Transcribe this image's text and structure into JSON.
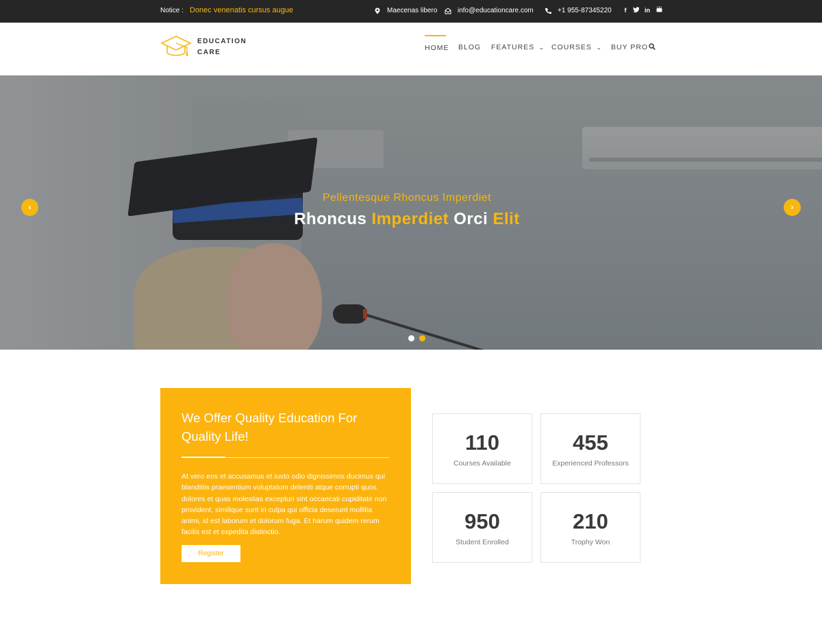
{
  "topbar": {
    "notice_label": "Notice :",
    "notice_text": "Donec venenatis cursus augue",
    "location": "Maecenas libero",
    "email": "info@educationcare.com",
    "phone": "+1 955-87345220",
    "social": [
      "facebook-icon",
      "twitter-icon",
      "linkedin-icon",
      "youtube-icon"
    ]
  },
  "header": {
    "logo_line1": "EDUCATION",
    "logo_line2": "CARE",
    "nav": [
      {
        "label": "HOME",
        "active": true
      },
      {
        "label": "BLOG"
      },
      {
        "label": "FEATURES",
        "dropdown": true
      },
      {
        "label": "COURSES",
        "dropdown": true
      },
      {
        "label": "BUY PRO"
      }
    ]
  },
  "hero": {
    "subtitle": "Pellentesque Rhoncus Imperdiet",
    "title_parts": [
      "Rhoncus",
      "Imperdiet",
      "Orci",
      "Elit"
    ],
    "prev_arrow": "‹",
    "next_arrow": "›",
    "slides": 2,
    "active_slide": 1
  },
  "offer": {
    "heading": "We Offer Quality Education For Quality Life!",
    "body": "At vero eos et accusamus et iusto odio dignissimos ducimus qui blanditiis praesentium voluptatum deleniti atque corrupti quos dolores et quas molestias excepturi sint occaecati cupiditate non provident, similique sunt in culpa qui officia deserunt mollitia animi, id est laborum et dolorum fuga. Et harum quidem rerum facilis est et expedita distinctio.",
    "button": "Register"
  },
  "stats": [
    {
      "value": "110",
      "label": "Courses Available"
    },
    {
      "value": "455",
      "label": "Experienced Professors"
    },
    {
      "value": "950",
      "label": "Student Enrolled"
    },
    {
      "value": "210",
      "label": "Trophy Won"
    }
  ],
  "colors": {
    "accent": "#f7b70f",
    "offer_bg": "#fcb30d",
    "topbar_bg": "#262626"
  }
}
